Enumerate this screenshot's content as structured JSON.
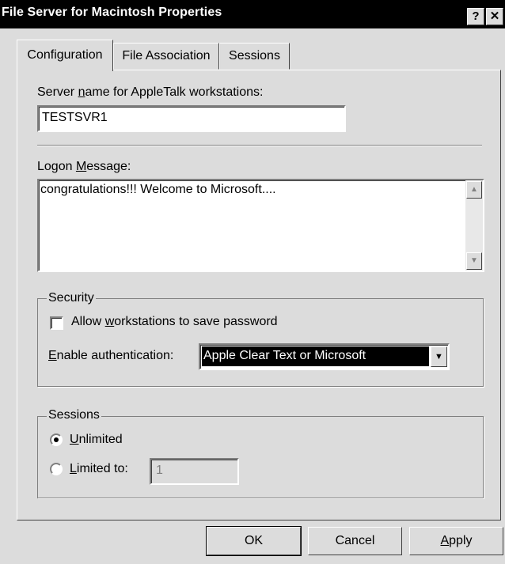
{
  "window": {
    "title": "File Server for Macintosh Properties",
    "help_label": "?",
    "close_label": "✕"
  },
  "tabs": [
    {
      "label": "Configuration",
      "active": true
    },
    {
      "label": "File Association",
      "active": false
    },
    {
      "label": "Sessions",
      "active": false
    }
  ],
  "config": {
    "server_name_label": "Server name for AppleTalk workstations:",
    "server_name_value": "TESTSVR1",
    "logon_label": "Logon Message:",
    "logon_value": "congratulations!!!  Welcome to Microsoft....",
    "security": {
      "legend": "Security",
      "allow_label": "Allow workstations to save password",
      "allow_checked": false,
      "auth_label": "Enable authentication:",
      "auth_value": "Apple Clear Text or Microsoft"
    },
    "sessions": {
      "legend": "Sessions",
      "unlimited_label": "Unlimited",
      "unlimited_selected": true,
      "limited_label": "Limited to:",
      "limited_value": "1"
    }
  },
  "buttons": {
    "ok": "OK",
    "cancel": "Cancel",
    "apply": "Apply"
  }
}
